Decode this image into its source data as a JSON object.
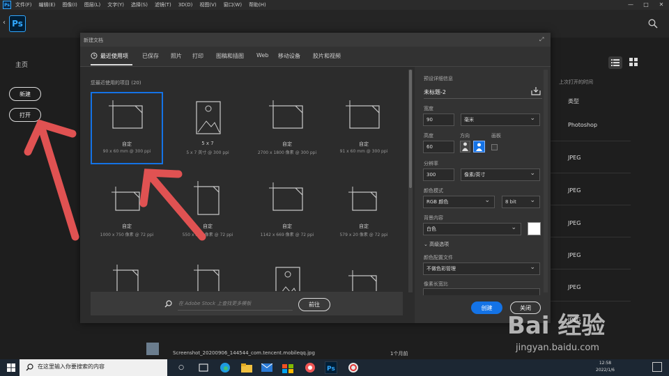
{
  "menubar": {
    "items": [
      "文件(F)",
      "编辑(E)",
      "图像(I)",
      "图层(L)",
      "文字(Y)",
      "选择(S)",
      "滤镜(T)",
      "3D(D)",
      "视图(V)",
      "窗口(W)",
      "帮助(H)"
    ],
    "ps_mini": "Ps",
    "win_min": "—",
    "win_max": "□",
    "win_close": "✕"
  },
  "app": {
    "logo": "Ps",
    "back": "‹"
  },
  "home": {
    "title": "主页",
    "new_label": "新建",
    "open_label": "打开",
    "col_header": "上次打开的时间",
    "col_type": "类型",
    "rows": [
      {
        "size": "",
        "type": "Photoshop"
      },
      {
        "size": "",
        "type": "JPEG"
      },
      {
        "size": "",
        "type": "JPEG"
      },
      {
        "size": "",
        "type": "JPEG"
      },
      {
        "size": "",
        "type": "JPEG"
      },
      {
        "size": "",
        "type": "JPEG"
      },
      {
        "size": "",
        "type": "JPEG"
      }
    ],
    "bottom_file": {
      "name": "Screenshot_20200906_144544_com.tencent.mobileqq.jpg",
      "time": "1个月前"
    }
  },
  "dialog": {
    "title": "新建文档",
    "close": "⤢",
    "tabs": [
      "最近使用项",
      "已保存",
      "照片",
      "打印",
      "图稿和插图",
      "Web",
      "移动设备",
      "胶片和视频"
    ],
    "recent_heading": "您最近使用的项目 (20)",
    "presets": [
      {
        "name": "自定",
        "desc": "90 x 60 mm @ 300 ppi",
        "icon": "doc-landscape"
      },
      {
        "name": "5 x 7",
        "desc": "5 x 7 英寸 @ 300 ppi",
        "icon": "image-portrait"
      },
      {
        "name": "自定",
        "desc": "2700 x 1800 像素 @ 300 ppi",
        "icon": "doc-landscape"
      },
      {
        "name": "自定",
        "desc": "91 x 60 mm @ 300 ppi",
        "icon": "doc-landscape"
      },
      {
        "name": "自定",
        "desc": "1000 x 750 像素 @ 72 ppi",
        "icon": "doc-landscape-small"
      },
      {
        "name": "自定",
        "desc": "550 x 800 像素 @ 72 ppi",
        "icon": "doc-portrait"
      },
      {
        "name": "自定",
        "desc": "1142 x 669 像素 @ 72 ppi",
        "icon": "doc-landscape"
      },
      {
        "name": "自定",
        "desc": "579 x 20 像素 @ 72 ppi",
        "icon": "doc-landscape-small"
      },
      {
        "name": "",
        "desc": "",
        "icon": "doc-portrait"
      },
      {
        "name": "",
        "desc": "",
        "icon": "doc-portrait"
      },
      {
        "name": "",
        "desc": "",
        "icon": "image-portrait"
      },
      {
        "name": "",
        "desc": "",
        "icon": "doc-landscape-small"
      }
    ],
    "stock_placeholder": "在 Adobe Stock 上查找更多模板",
    "go_label": "前往",
    "details": {
      "heading": "预设详细信息",
      "doc_name": "未标题-2",
      "width_label": "宽度",
      "width_value": "90",
      "unit_value": "毫米",
      "height_label": "高度",
      "height_value": "60",
      "orient_label": "方向",
      "artboard_label": "画板",
      "res_label": "分辨率",
      "res_value": "300",
      "res_unit": "像素/英寸",
      "color_mode_label": "颜色模式",
      "color_mode_value": "RGB 颜色",
      "bit_value": "8 bit",
      "bg_label": "背景内容",
      "bg_value": "白色",
      "advanced_label": "高级选项",
      "profile_label": "颜色配置文件",
      "profile_value": "不做色彩管理",
      "pixel_aspect_label": "像素长宽比",
      "create_label": "创建",
      "close_label": "关闭"
    }
  },
  "taskbar": {
    "search_text": "在这里输入你要搜索的内容",
    "time": "12:58",
    "date": "2022/1/6"
  },
  "watermark": {
    "brand": "Bai 经验",
    "url": "jingyan.baidu.com"
  },
  "colors": {
    "accent": "#1473e6",
    "arrow": "#e05252",
    "ps_blue": "#31a8ff"
  }
}
